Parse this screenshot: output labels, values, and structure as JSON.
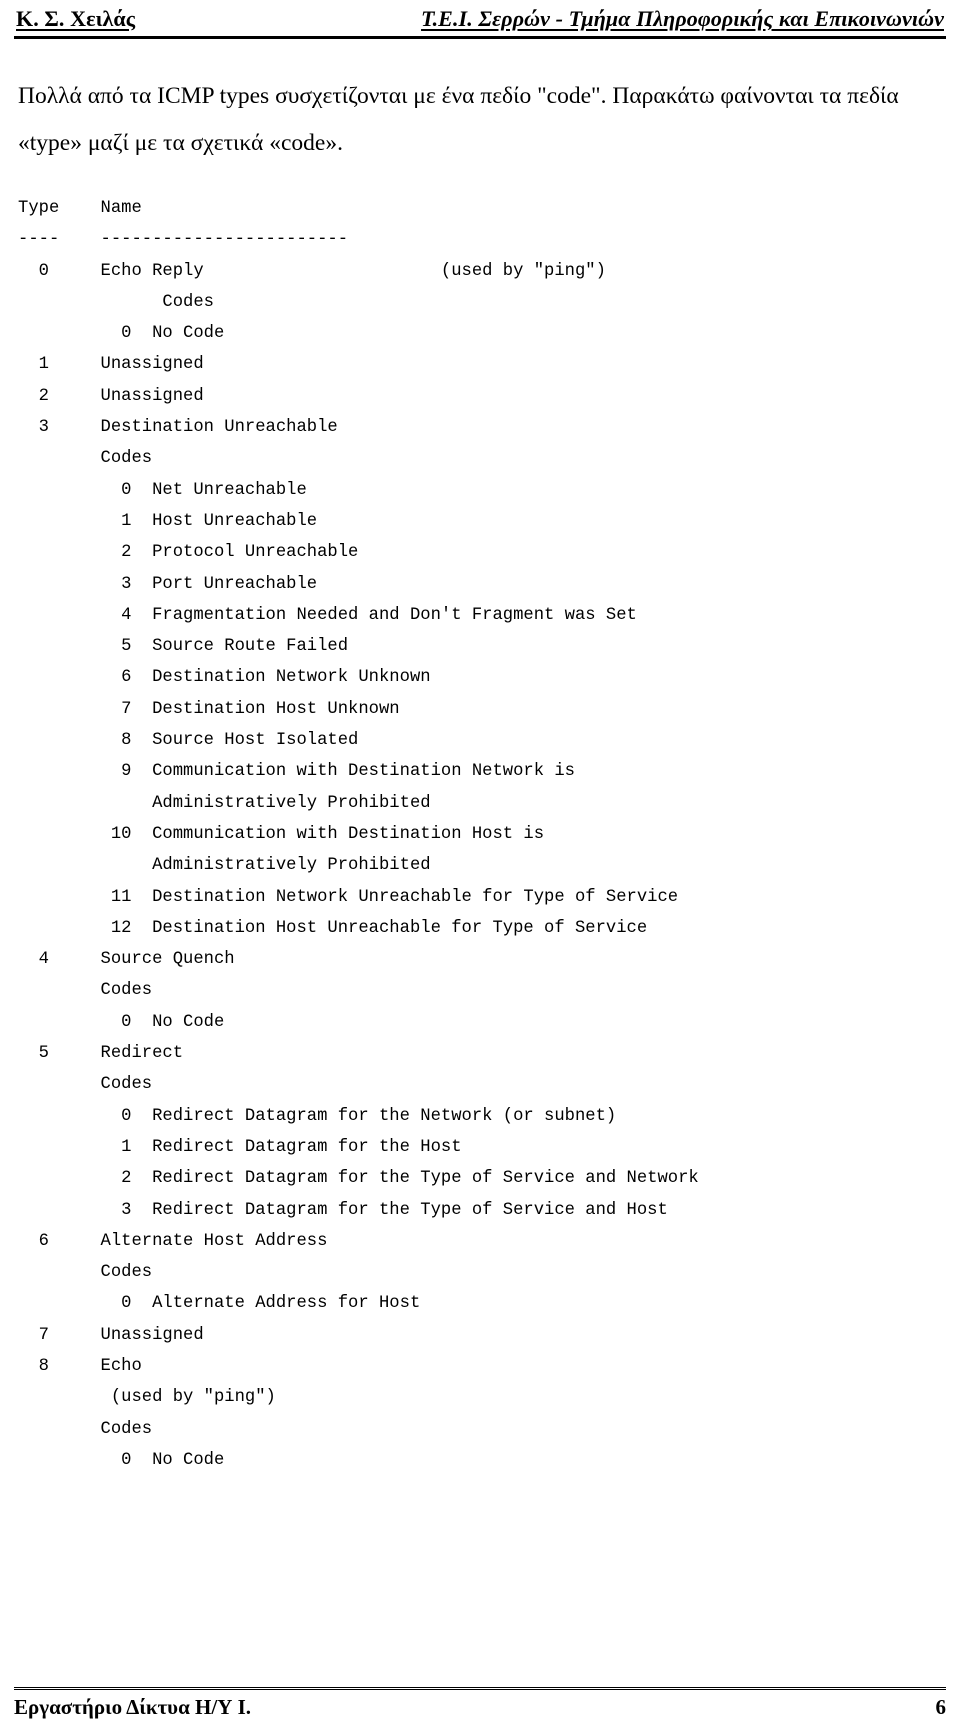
{
  "header": {
    "left": "Κ. Σ. Χειλάς",
    "right": "Τ.Ε.Ι. Σερρών - Τμήμα Πληροφορικής και Επικοινωνιών"
  },
  "intro": {
    "paragraph": "Πολλά από τα ICMP types συσχετίζονται με ένα πεδίο \"code\". Παρακάτω φαίνονται τα πεδία «type» μαζί με τα σχετικά «code»."
  },
  "listing": {
    "columns": [
      "Type",
      "Name"
    ],
    "separator": "----    ------------------------",
    "lines": [
      "Type    Name",
      "----    ------------------------",
      "  0     Echo Reply                       (used by \"ping\")",
      "              Codes",
      "          0  No Code",
      "  1     Unassigned",
      "  2     Unassigned",
      "  3     Destination Unreachable",
      "        Codes",
      "          0  Net Unreachable",
      "          1  Host Unreachable",
      "          2  Protocol Unreachable",
      "          3  Port Unreachable",
      "          4  Fragmentation Needed and Don't Fragment was Set",
      "          5  Source Route Failed",
      "          6  Destination Network Unknown",
      "          7  Destination Host Unknown",
      "          8  Source Host Isolated",
      "          9  Communication with Destination Network is",
      "             Administratively Prohibited",
      "         10  Communication with Destination Host is",
      "             Administratively Prohibited",
      "         11  Destination Network Unreachable for Type of Service",
      "         12  Destination Host Unreachable for Type of Service",
      "  4     Source Quench",
      "        Codes",
      "          0  No Code",
      "  5     Redirect",
      "        Codes",
      "          0  Redirect Datagram for the Network (or subnet)",
      "          1  Redirect Datagram for the Host",
      "          2  Redirect Datagram for the Type of Service and Network",
      "          3  Redirect Datagram for the Type of Service and Host",
      "  6     Alternate Host Address",
      "        Codes",
      "          0  Alternate Address for Host",
      "  7     Unassigned",
      "  8     Echo",
      "         (used by \"ping\")",
      "        Codes",
      "          0  No Code"
    ],
    "types": [
      {
        "type": "0",
        "name": "Echo Reply",
        "note": "(used by \"ping\")",
        "codes_label": "Codes",
        "codes": [
          {
            "code": "0",
            "name": "No Code"
          }
        ]
      },
      {
        "type": "1",
        "name": "Unassigned",
        "codes": []
      },
      {
        "type": "2",
        "name": "Unassigned",
        "codes": []
      },
      {
        "type": "3",
        "name": "Destination Unreachable",
        "codes_label": "Codes",
        "codes": [
          {
            "code": "0",
            "name": "Net Unreachable"
          },
          {
            "code": "1",
            "name": "Host Unreachable"
          },
          {
            "code": "2",
            "name": "Protocol Unreachable"
          },
          {
            "code": "3",
            "name": "Port Unreachable"
          },
          {
            "code": "4",
            "name": "Fragmentation Needed and Don't Fragment was Set"
          },
          {
            "code": "5",
            "name": "Source Route Failed"
          },
          {
            "code": "6",
            "name": "Destination Network Unknown"
          },
          {
            "code": "7",
            "name": "Destination Host Unknown"
          },
          {
            "code": "8",
            "name": "Source Host Isolated"
          },
          {
            "code": "9",
            "name": "Communication with Destination Network is Administratively Prohibited"
          },
          {
            "code": "10",
            "name": "Communication with Destination Host is Administratively Prohibited"
          },
          {
            "code": "11",
            "name": "Destination Network Unreachable for Type of Service"
          },
          {
            "code": "12",
            "name": "Destination Host Unreachable for Type of Service"
          }
        ]
      },
      {
        "type": "4",
        "name": "Source Quench",
        "codes_label": "Codes",
        "codes": [
          {
            "code": "0",
            "name": "No Code"
          }
        ]
      },
      {
        "type": "5",
        "name": "Redirect",
        "codes_label": "Codes",
        "codes": [
          {
            "code": "0",
            "name": "Redirect Datagram for the Network (or subnet)"
          },
          {
            "code": "1",
            "name": "Redirect Datagram for the Host"
          },
          {
            "code": "2",
            "name": "Redirect Datagram for the Type of Service and Network"
          },
          {
            "code": "3",
            "name": "Redirect Datagram for the Type of Service and Host"
          }
        ]
      },
      {
        "type": "6",
        "name": "Alternate Host Address",
        "codes_label": "Codes",
        "codes": [
          {
            "code": "0",
            "name": "Alternate Address for Host"
          }
        ]
      },
      {
        "type": "7",
        "name": "Unassigned",
        "codes": []
      },
      {
        "type": "8",
        "name": "Echo",
        "note": "(used by \"ping\")",
        "codes_label": "Codes",
        "codes": [
          {
            "code": "0",
            "name": "No Code"
          }
        ]
      }
    ]
  },
  "footer": {
    "left": "Εργαστήριο Δίκτυα Η/Υ Ι.",
    "page": "6"
  }
}
